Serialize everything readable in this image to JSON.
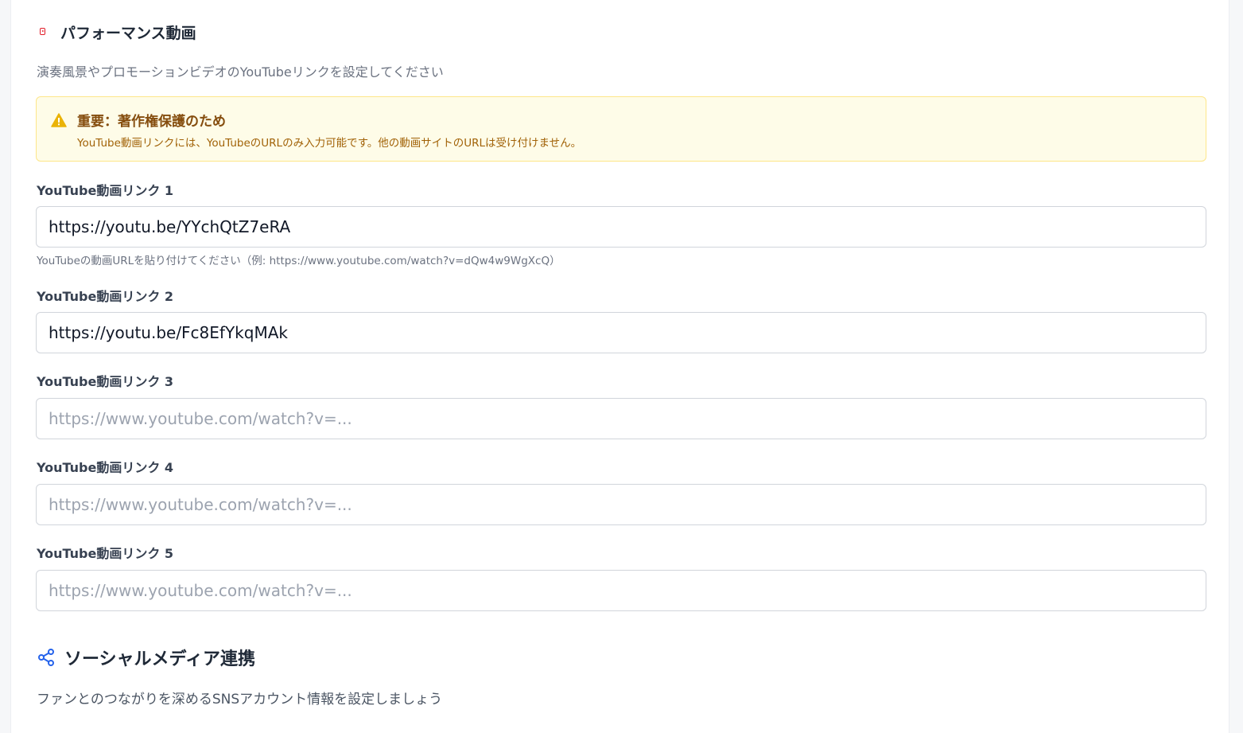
{
  "video_section": {
    "icon": "youtube-icon",
    "title": "パフォーマンス動画",
    "description": "演奏風景やプロモーションビデオのYouTubeリンクを設定してください",
    "warning": {
      "icon": "warning-triangle-icon",
      "title": "重要：著作権保護のため",
      "text": "YouTube動画リンクには、YouTubeのURLのみ入力可能です。他の動画サイトのURLは受け付けません。"
    },
    "fields": [
      {
        "label": "YouTube動画リンク 1",
        "value": "https://youtu.be/YYchQtZ7eRA",
        "placeholder": "https://www.youtube.com/watch?v=..."
      },
      {
        "label": "YouTube動画リンク 2",
        "value": "https://youtu.be/Fc8EfYkqMAk",
        "placeholder": "https://www.youtube.com/watch?v=..."
      },
      {
        "label": "YouTube動画リンク 3",
        "value": "",
        "placeholder": "https://www.youtube.com/watch?v=..."
      },
      {
        "label": "YouTube動画リンク 4",
        "value": "",
        "placeholder": "https://www.youtube.com/watch?v=..."
      },
      {
        "label": "YouTube動画リンク 5",
        "value": "",
        "placeholder": "https://www.youtube.com/watch?v=..."
      }
    ],
    "help_text": "YouTubeの動画URLを貼り付けてください（例: https://www.youtube.com/watch?v=dQw4w9WgXcQ）"
  },
  "social_section": {
    "icon": "share-icon",
    "title": "ソーシャルメディア連携",
    "description": "ファンとのつながりを深めるSNSアカウント情報を設定しましょう"
  },
  "colors": {
    "youtube_red": "#e11d2a",
    "warning_bg": "#fefce8",
    "warning_border": "#fde68a",
    "warning_title": "#854d0e",
    "warning_text": "#a16207",
    "accent_blue": "#2563eb"
  }
}
